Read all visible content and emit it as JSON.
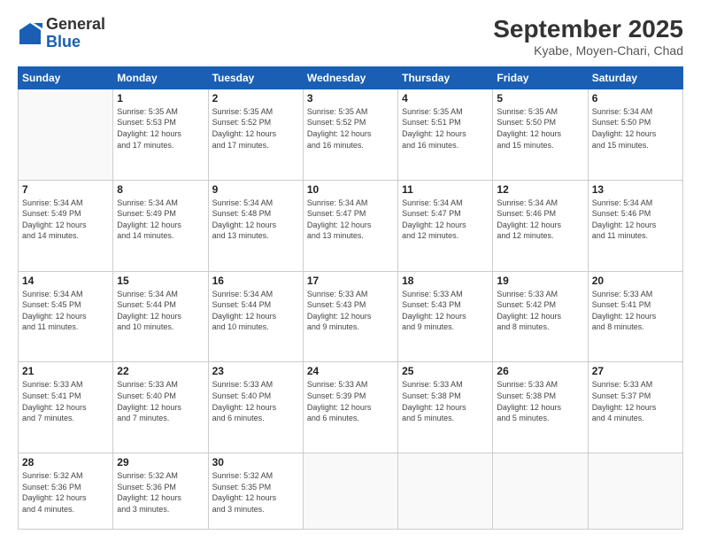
{
  "header": {
    "logo": {
      "general": "General",
      "blue": "Blue"
    },
    "title": "September 2025",
    "subtitle": "Kyabe, Moyen-Chari, Chad"
  },
  "days_of_week": [
    "Sunday",
    "Monday",
    "Tuesday",
    "Wednesday",
    "Thursday",
    "Friday",
    "Saturday"
  ],
  "weeks": [
    [
      {
        "day": "",
        "info": ""
      },
      {
        "day": "1",
        "info": "Sunrise: 5:35 AM\nSunset: 5:53 PM\nDaylight: 12 hours\nand 17 minutes."
      },
      {
        "day": "2",
        "info": "Sunrise: 5:35 AM\nSunset: 5:52 PM\nDaylight: 12 hours\nand 17 minutes."
      },
      {
        "day": "3",
        "info": "Sunrise: 5:35 AM\nSunset: 5:52 PM\nDaylight: 12 hours\nand 16 minutes."
      },
      {
        "day": "4",
        "info": "Sunrise: 5:35 AM\nSunset: 5:51 PM\nDaylight: 12 hours\nand 16 minutes."
      },
      {
        "day": "5",
        "info": "Sunrise: 5:35 AM\nSunset: 5:50 PM\nDaylight: 12 hours\nand 15 minutes."
      },
      {
        "day": "6",
        "info": "Sunrise: 5:34 AM\nSunset: 5:50 PM\nDaylight: 12 hours\nand 15 minutes."
      }
    ],
    [
      {
        "day": "7",
        "info": "Sunrise: 5:34 AM\nSunset: 5:49 PM\nDaylight: 12 hours\nand 14 minutes."
      },
      {
        "day": "8",
        "info": "Sunrise: 5:34 AM\nSunset: 5:49 PM\nDaylight: 12 hours\nand 14 minutes."
      },
      {
        "day": "9",
        "info": "Sunrise: 5:34 AM\nSunset: 5:48 PM\nDaylight: 12 hours\nand 13 minutes."
      },
      {
        "day": "10",
        "info": "Sunrise: 5:34 AM\nSunset: 5:47 PM\nDaylight: 12 hours\nand 13 minutes."
      },
      {
        "day": "11",
        "info": "Sunrise: 5:34 AM\nSunset: 5:47 PM\nDaylight: 12 hours\nand 12 minutes."
      },
      {
        "day": "12",
        "info": "Sunrise: 5:34 AM\nSunset: 5:46 PM\nDaylight: 12 hours\nand 12 minutes."
      },
      {
        "day": "13",
        "info": "Sunrise: 5:34 AM\nSunset: 5:46 PM\nDaylight: 12 hours\nand 11 minutes."
      }
    ],
    [
      {
        "day": "14",
        "info": "Sunrise: 5:34 AM\nSunset: 5:45 PM\nDaylight: 12 hours\nand 11 minutes."
      },
      {
        "day": "15",
        "info": "Sunrise: 5:34 AM\nSunset: 5:44 PM\nDaylight: 12 hours\nand 10 minutes."
      },
      {
        "day": "16",
        "info": "Sunrise: 5:34 AM\nSunset: 5:44 PM\nDaylight: 12 hours\nand 10 minutes."
      },
      {
        "day": "17",
        "info": "Sunrise: 5:33 AM\nSunset: 5:43 PM\nDaylight: 12 hours\nand 9 minutes."
      },
      {
        "day": "18",
        "info": "Sunrise: 5:33 AM\nSunset: 5:43 PM\nDaylight: 12 hours\nand 9 minutes."
      },
      {
        "day": "19",
        "info": "Sunrise: 5:33 AM\nSunset: 5:42 PM\nDaylight: 12 hours\nand 8 minutes."
      },
      {
        "day": "20",
        "info": "Sunrise: 5:33 AM\nSunset: 5:41 PM\nDaylight: 12 hours\nand 8 minutes."
      }
    ],
    [
      {
        "day": "21",
        "info": "Sunrise: 5:33 AM\nSunset: 5:41 PM\nDaylight: 12 hours\nand 7 minutes."
      },
      {
        "day": "22",
        "info": "Sunrise: 5:33 AM\nSunset: 5:40 PM\nDaylight: 12 hours\nand 7 minutes."
      },
      {
        "day": "23",
        "info": "Sunrise: 5:33 AM\nSunset: 5:40 PM\nDaylight: 12 hours\nand 6 minutes."
      },
      {
        "day": "24",
        "info": "Sunrise: 5:33 AM\nSunset: 5:39 PM\nDaylight: 12 hours\nand 6 minutes."
      },
      {
        "day": "25",
        "info": "Sunrise: 5:33 AM\nSunset: 5:38 PM\nDaylight: 12 hours\nand 5 minutes."
      },
      {
        "day": "26",
        "info": "Sunrise: 5:33 AM\nSunset: 5:38 PM\nDaylight: 12 hours\nand 5 minutes."
      },
      {
        "day": "27",
        "info": "Sunrise: 5:33 AM\nSunset: 5:37 PM\nDaylight: 12 hours\nand 4 minutes."
      }
    ],
    [
      {
        "day": "28",
        "info": "Sunrise: 5:32 AM\nSunset: 5:36 PM\nDaylight: 12 hours\nand 4 minutes."
      },
      {
        "day": "29",
        "info": "Sunrise: 5:32 AM\nSunset: 5:36 PM\nDaylight: 12 hours\nand 3 minutes."
      },
      {
        "day": "30",
        "info": "Sunrise: 5:32 AM\nSunset: 5:35 PM\nDaylight: 12 hours\nand 3 minutes."
      },
      {
        "day": "",
        "info": ""
      },
      {
        "day": "",
        "info": ""
      },
      {
        "day": "",
        "info": ""
      },
      {
        "day": "",
        "info": ""
      }
    ]
  ]
}
